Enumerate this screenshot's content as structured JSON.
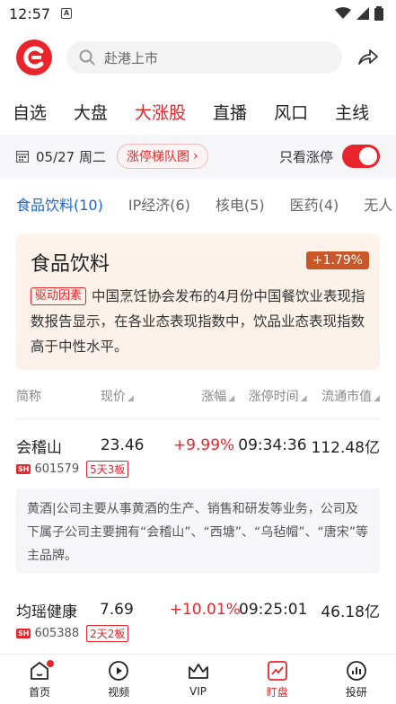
{
  "status_bar": {
    "time": "12:57",
    "notif_icon": "A"
  },
  "search": {
    "placeholder": "赴港上市"
  },
  "nav_tabs": [
    "自选",
    "大盘",
    "大涨股",
    "直播",
    "风口",
    "主线"
  ],
  "nav_active": "大涨股",
  "date_bar": {
    "date": "05/27 周二",
    "ladder_label": "涨停梯队图",
    "toggle_label": "只看涨停",
    "toggle_on": true
  },
  "sector_tabs": [
    {
      "label": "食品饮料(10)",
      "active": true
    },
    {
      "label": "IP经济(6)",
      "active": false
    },
    {
      "label": "核电(5)",
      "active": false
    },
    {
      "label": "医药(4)",
      "active": false
    },
    {
      "label": "无人",
      "active": false
    }
  ],
  "sector_card": {
    "title": "食品饮料",
    "change": "+1.79%",
    "driver_tag": "驱动因素",
    "description": "中国烹饪协会发布的4月份中国餐饮业表现指数报告显示，在各业态表现指数中，饮品业态表现指数高于中性水平。"
  },
  "table_headers": {
    "name": "简称",
    "price": "现价",
    "change": "涨幅",
    "time": "涨停时间",
    "cap": "流通市值"
  },
  "stocks": [
    {
      "name": "会稽山",
      "price": "23.46",
      "change": "+9.99%",
      "time": "09:34:36",
      "cap": "112.48亿",
      "market": "SH",
      "code": "601579",
      "board": "5天3板",
      "desc": "黄酒|公司主要从事黄酒的生产、销售和研发等业务，公司及下属子公司主要拥有“会稽山”、“西塘”、“乌毡帽”、“唐宋”等主品牌。"
    },
    {
      "name": "均瑶健康",
      "price": "7.69",
      "change": "+10.01%",
      "time": "09:25:01",
      "cap": "46.18亿",
      "market": "SH",
      "code": "605388",
      "board": "2天2板",
      "desc": ""
    }
  ],
  "bottom_nav": [
    {
      "label": "首页",
      "icon": "home-icon",
      "active": false,
      "dot": true
    },
    {
      "label": "视频",
      "icon": "play-icon",
      "active": false,
      "dot": false
    },
    {
      "label": "VIP",
      "icon": "crown-icon",
      "active": false,
      "dot": false
    },
    {
      "label": "盯盘",
      "icon": "chart-icon",
      "active": true,
      "dot": false
    },
    {
      "label": "投研",
      "icon": "research-icon",
      "active": false,
      "dot": false
    }
  ],
  "colors": {
    "accent": "#e8252b",
    "tab_blue": "#1a64d6",
    "sector_tag": "#c8572a"
  }
}
